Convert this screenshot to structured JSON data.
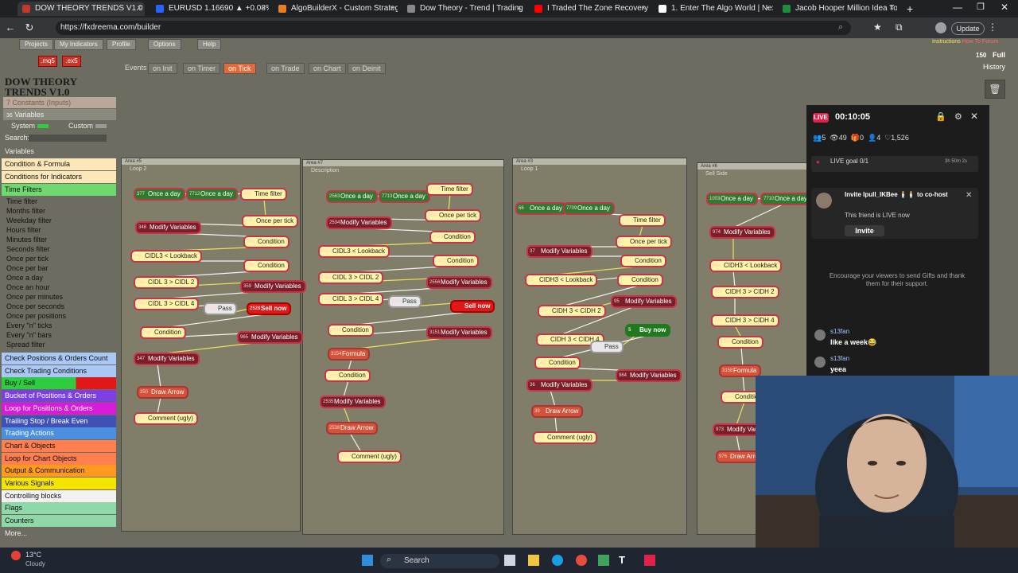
{
  "browser": {
    "tabs": [
      {
        "title": "DOW THEORY TRENDS V1.0",
        "active": true,
        "color": "#c0392b"
      },
      {
        "title": "EURUSD 1.16690 ▲ +0.08% Q4",
        "active": false,
        "color": "#2962ff"
      },
      {
        "title": "AlgoBuilderX - Custom Strategie",
        "active": false,
        "color": "#e67e22"
      },
      {
        "title": "Dow Theory - Trend | Trading St",
        "active": false,
        "color": "#888888"
      },
      {
        "title": "I Traded The Zone Recovery Trad",
        "active": false,
        "color": "#ff0000"
      },
      {
        "title": "1. Enter The Algo World | NexGen",
        "active": false,
        "color": "#ffffff"
      },
      {
        "title": "Jacob Hooper Million Idea Tool",
        "active": false,
        "color": "#1e8e3e"
      }
    ],
    "url": "https://fxdreema.com/builder",
    "update_label": "Update"
  },
  "fxdreema": {
    "top_menu": [
      "Projects",
      "My Indicators",
      "Profile",
      "Options",
      "Help"
    ],
    "right_links": [
      "Instructions",
      "How To",
      "Forum"
    ],
    "mq5_label": ".mq5",
    "ex5_label": ".ex5",
    "history_label": "History",
    "full_label": "Full",
    "zoom_value": "150",
    "project_title_line1": "DOW THEORY",
    "project_title_line2": "TRENDS V1.0",
    "constants_label": "Constants (Inputs)",
    "constants_count": "7",
    "variables_label": "Variables",
    "variables_count": "36",
    "system_label": "System",
    "custom_label": "Custom",
    "search_label": "Search:",
    "event_tabs": [
      "Events",
      "on Init",
      "on Timer",
      "on Tick",
      "on Trade",
      "on Chart",
      "on Deinit"
    ],
    "active_event": "on Tick",
    "categories_top": [
      {
        "label": "Variables",
        "color": "#6c6c60"
      },
      {
        "label": "Condition & Formula",
        "color": "#fde7b8"
      },
      {
        "label": "Conditions for Indicators",
        "color": "#fde7b8"
      },
      {
        "label": "Time Filters",
        "color": "#6fd86f"
      }
    ],
    "time_filter_items": [
      "Time filter",
      "Months filter",
      "Weekday filter",
      "Hours filter",
      "Minutes filter",
      "Seconds filter",
      "Once per tick",
      "Once per bar",
      "Once a day",
      "Once an hour",
      "Once per minutes",
      "Once per seconds",
      "Once per positions",
      "Every \"n\" ticks",
      "Every \"n\" bars",
      "Spread filter"
    ],
    "categories_bottom": [
      {
        "label": "Check Positions & Orders Count",
        "color": "#a9c8f5"
      },
      {
        "label": "Check Trading Conditions",
        "color": "#a9c8f5"
      },
      {
        "label": "Buy / Sell",
        "color": "#2ecc40",
        "accent": "#e01818"
      },
      {
        "label": "Bucket of Positions & Orders",
        "color": "#7b3fe4"
      },
      {
        "label": "Loop for Positions & Orders",
        "color": "#d81bd8"
      },
      {
        "label": "Trailing Stop / Break Even",
        "color": "#3f51b5"
      },
      {
        "label": "Trading Actions",
        "color": "#4a8fe0"
      },
      {
        "label": "Chart & Objects",
        "color": "#ff7f50"
      },
      {
        "label": "Loop for Chart Objects",
        "color": "#ff7f50"
      },
      {
        "label": "Output & Communication",
        "color": "#ff9a1f"
      },
      {
        "label": "Various Signals",
        "color": "#f5e400"
      },
      {
        "label": "Controlling blocks",
        "color": "#f2f2f2"
      },
      {
        "label": "Flags",
        "color": "#8fd9a8"
      },
      {
        "label": "Counters",
        "color": "#8fd9a8"
      },
      {
        "label": "More...",
        "color": "#6c6c60"
      }
    ],
    "areas": [
      {
        "header": "Area #5",
        "sub": "Loop 2"
      },
      {
        "header": "Area #7",
        "sub": "Description"
      },
      {
        "header": "Area #3",
        "sub": "Loop 1"
      },
      {
        "header": "Area #6",
        "sub": "Sell Side"
      }
    ],
    "nodes_a1": [
      {
        "id": "377",
        "label": "Once a day",
        "t": "g"
      },
      {
        "id": "7712",
        "label": "Once a day",
        "t": "g"
      },
      {
        "id": "433",
        "label": "Time filter",
        "t": "y"
      },
      {
        "id": "370",
        "label": "Once per tick",
        "t": "y"
      },
      {
        "id": "348",
        "label": "Modify Variables",
        "t": ""
      },
      {
        "id": "962",
        "label": "Condition",
        "t": "y"
      },
      {
        "id": "343",
        "label": "CIDL3 < Lookback",
        "t": "y"
      },
      {
        "id": "366",
        "label": "Condition",
        "t": "y"
      },
      {
        "id": "345",
        "label": "CIDL 3 > CIDL 2",
        "t": "y"
      },
      {
        "id": "359",
        "label": "Modify Variables",
        "t": ""
      },
      {
        "id": "346",
        "label": "CIDL 3 > CIDL 4",
        "t": "y"
      },
      {
        "id": "3150",
        "label": "Pass",
        "t": "w"
      },
      {
        "id": "2528",
        "label": "Sell now",
        "t": "r"
      },
      {
        "id": "453",
        "label": "Condition",
        "t": "y"
      },
      {
        "id": "965",
        "label": "Modify Variables",
        "t": ""
      },
      {
        "id": "347",
        "label": "Modify Variables",
        "t": ""
      },
      {
        "id": "350",
        "label": "Draw Arrow",
        "t": "o"
      },
      {
        "id": "651",
        "label": "Comment (ugly)",
        "t": "y"
      }
    ],
    "nodes_a2": [
      {
        "id": "2563",
        "label": "Once a day",
        "t": "g"
      },
      {
        "id": "7713",
        "label": "Once a day",
        "t": "g"
      },
      {
        "id": "2619",
        "label": "Time filter",
        "t": "y"
      },
      {
        "id": "2562",
        "label": "Once per tick",
        "t": "y"
      },
      {
        "id": "2534",
        "label": "Modify Variables",
        "t": ""
      },
      {
        "id": "3148",
        "label": "Condition",
        "t": "y"
      },
      {
        "id": "2529",
        "label": "CIDL3 < Lookback",
        "t": "y"
      },
      {
        "id": "2552",
        "label": "Condition",
        "t": "y"
      },
      {
        "id": "2531",
        "label": "CIDL 3 > CIDL 2",
        "t": "y"
      },
      {
        "id": "2556",
        "label": "Modify Variables",
        "t": ""
      },
      {
        "id": "2532",
        "label": "CIDL 3 > CIDL 4",
        "t": "y"
      },
      {
        "id": "3160",
        "label": "Pass",
        "t": "w"
      },
      {
        "id": "",
        "label": "Sell now",
        "t": "r"
      },
      {
        "id": "2613",
        "label": "Condition",
        "t": "y"
      },
      {
        "id": "3151",
        "label": "Modify Variables",
        "t": ""
      },
      {
        "id": "3154",
        "label": "Formula",
        "t": "o"
      },
      {
        "id": "3153",
        "label": "Condition",
        "t": "y"
      },
      {
        "id": "2535",
        "label": "Modify Variables",
        "t": ""
      },
      {
        "id": "2536",
        "label": "Draw Arrow",
        "t": "o"
      },
      {
        "id": "2837",
        "label": "Comment (ugly)",
        "t": "y"
      }
    ],
    "nodes_a3": [
      {
        "id": "66",
        "label": "Once a day",
        "t": "g"
      },
      {
        "id": "7709",
        "label": "Once a day",
        "t": "g"
      },
      {
        "id": "122",
        "label": "Time filter",
        "t": "y"
      },
      {
        "id": "67",
        "label": "Once per tick",
        "t": "y"
      },
      {
        "id": "37",
        "label": "Modify Variables",
        "t": ""
      },
      {
        "id": "961",
        "label": "Condition",
        "t": "y"
      },
      {
        "id": "32",
        "label": "CIDH3 < Lookback",
        "t": "y"
      },
      {
        "id": "",
        "label": "Condition",
        "t": "y"
      },
      {
        "id": "33",
        "label": "CIDH 3 < CIDH 2",
        "t": "y"
      },
      {
        "id": "95",
        "label": "Modify Variables",
        "t": ""
      },
      {
        "id": "34",
        "label": "CIDH 3 < CIDH 4",
        "t": "y"
      },
      {
        "id": "",
        "label": "Pass",
        "t": "w"
      },
      {
        "id": "5",
        "label": "Buy now",
        "t": "gb"
      },
      {
        "id": "142",
        "label": "Condition",
        "t": "y"
      },
      {
        "id": "964",
        "label": "Modify Variables",
        "t": ""
      },
      {
        "id": "36",
        "label": "Modify Variables",
        "t": ""
      },
      {
        "id": "39",
        "label": "Draw Arrow",
        "t": "o"
      },
      {
        "id": "360",
        "label": "Comment (ugly)",
        "t": "y"
      }
    ],
    "nodes_a4": [
      {
        "id": "1003",
        "label": "Once a day",
        "t": "g"
      },
      {
        "id": "7710",
        "label": "Once a day",
        "t": "g"
      },
      {
        "id": "974",
        "label": "Modify Variables",
        "t": ""
      },
      {
        "id": "969",
        "label": "CIDH3 < Lookback",
        "t": "y"
      },
      {
        "id": "971",
        "label": "CIDH 3 > CIDH 2",
        "t": "y"
      },
      {
        "id": "972",
        "label": "CIDH 3 > CIDH 4",
        "t": "y"
      },
      {
        "id": "1079",
        "label": "Condition",
        "t": "y"
      },
      {
        "id": "3158",
        "label": "Formula",
        "t": "o"
      },
      {
        "id": "3157",
        "label": "Condition",
        "t": "y"
      },
      {
        "id": "973",
        "label": "Modify Variables",
        "t": ""
      },
      {
        "id": "976",
        "label": "Draw Arrow",
        "t": "o"
      }
    ]
  },
  "live": {
    "badge": "LIVE",
    "timer": "00:10:05",
    "stats": {
      "viewers": "5",
      "views": "49",
      "gifts": "0",
      "shares": "4",
      "likes": "1,526"
    },
    "goal_label": "LIVE goal",
    "goal_value": "0/1",
    "goal_time": "3h 50m 2s",
    "invite_title": "Invite Ipull_IKBee 🕯️🕯️ to co-host",
    "invite_sub": "This friend is LIVE now",
    "invite_button": "Invite",
    "encourage": "Encourage your viewers to send Gifts and thank them for their support.",
    "chat": [
      {
        "user": "s13fan",
        "text": "like a week😂"
      },
      {
        "user": "s13fan",
        "text": "yeea"
      }
    ]
  },
  "taskbar": {
    "weather_temp": "13°C",
    "weather_desc": "Cloudy",
    "search_label": "Search"
  }
}
